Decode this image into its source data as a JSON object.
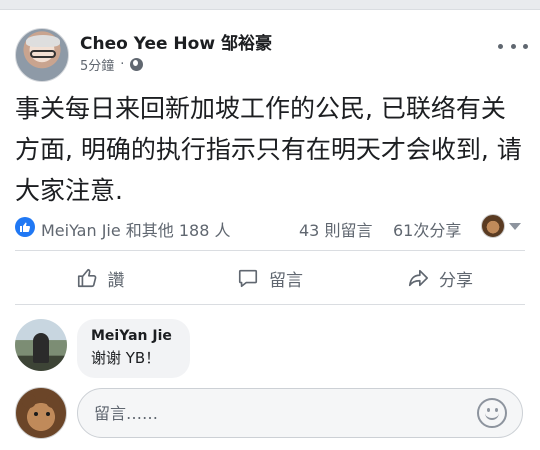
{
  "post": {
    "author": "Cheo Yee How 邹裕豪",
    "time": "5分鐘",
    "time_separator": "·",
    "privacy_icon": "globe-icon",
    "text": "事关每日来回新加坡工作的公民, 已联络有关方面, 明确的执行指示只有在明天才会收到, 请大家注意."
  },
  "reactions": {
    "summary": "MeiYan Jie 和其他 188 人",
    "comments": "43 則留言",
    "shares": "61次分享"
  },
  "actions": {
    "like_label": "讚",
    "comment_label": "留言",
    "share_label": "分享"
  },
  "comments": [
    {
      "name": "MeiYan Jie",
      "text": "谢谢 YB！"
    }
  ],
  "composer": {
    "placeholder": "留言……"
  },
  "colors": {
    "like_blue": "#2078f4",
    "secondary_text": "#606770",
    "bubble_bg": "#f2f3f5"
  }
}
